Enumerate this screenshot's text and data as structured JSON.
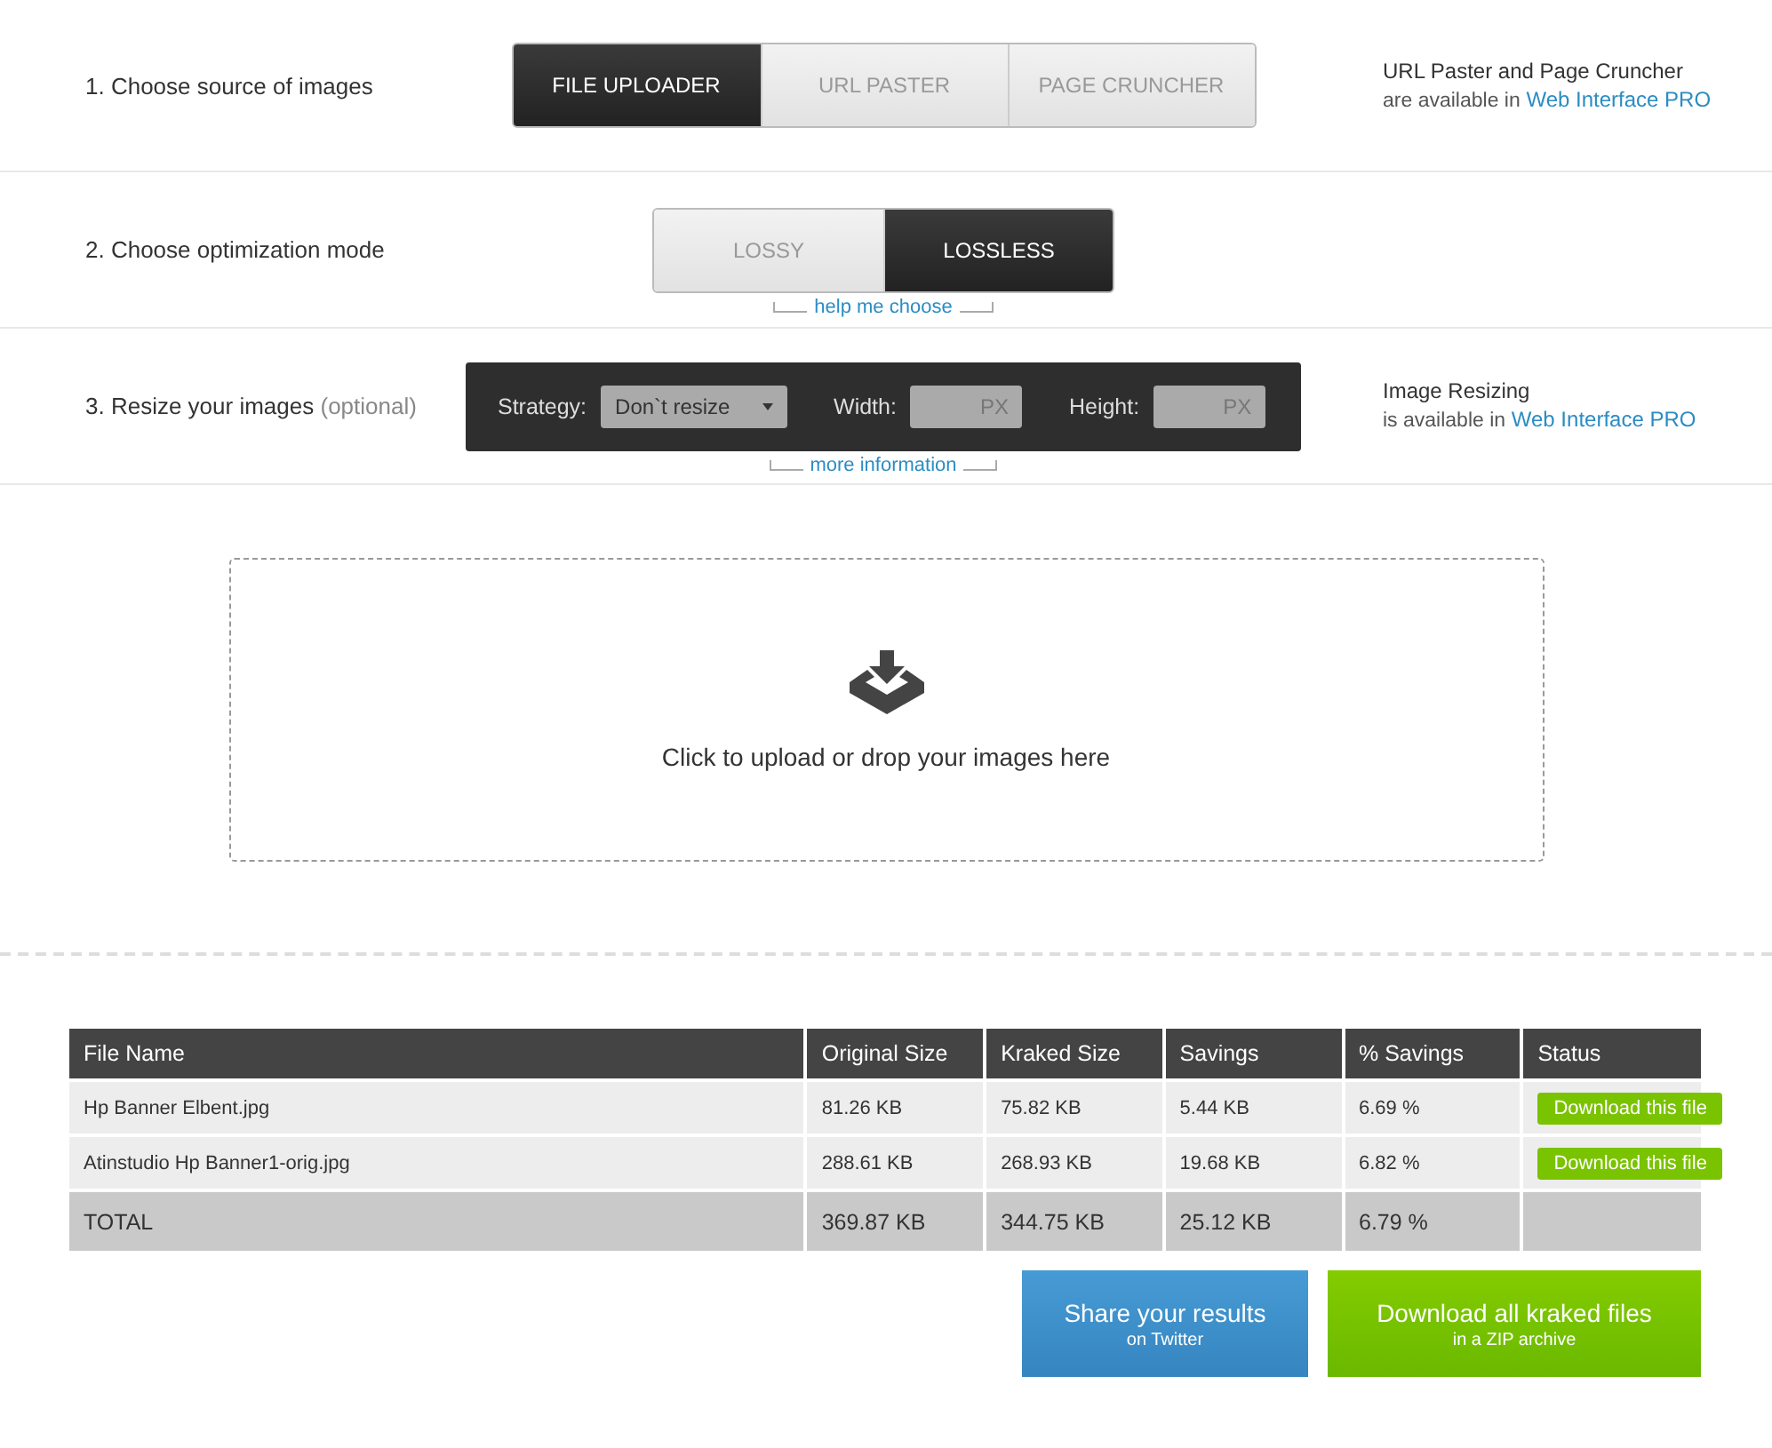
{
  "steps": [
    {
      "kind": "segmented",
      "label": "1. Choose source of images",
      "options": [
        {
          "label": "FILE UPLOADER",
          "selected": true
        },
        {
          "label": "URL PASTER",
          "selected": false
        },
        {
          "label": "PAGE CRUNCHER",
          "selected": false
        }
      ],
      "note": {
        "line1": "URL Paster and Page Cruncher",
        "line2": "are available in",
        "link": "Web Interface PRO"
      }
    },
    {
      "kind": "segmented",
      "label": "2. Choose optimization mode",
      "options": [
        {
          "label": "LOSSY",
          "selected": false
        },
        {
          "label": "LOSSLESS",
          "selected": true
        }
      ],
      "help": "help me choose"
    },
    {
      "kind": "resize",
      "label": "3. Resize your images",
      "hint": "(optional)",
      "strategy_label": "Strategy:",
      "strategy_value": "Don`t resize",
      "width_label": "Width:",
      "width_placeholder": "PX",
      "height_label": "Height:",
      "height_placeholder": "PX",
      "help": "more information",
      "note": {
        "line1": "Image Resizing",
        "line2": "is available in",
        "link": "Web Interface PRO"
      }
    }
  ],
  "dropzone": {
    "text": "Click to upload or drop your images here"
  },
  "table": {
    "columns": [
      "File Name",
      "Original Size",
      "Kraked Size",
      "Savings",
      "% Savings",
      "Status"
    ],
    "rows": [
      {
        "cells": [
          "Hp Banner Elbent.jpg",
          "81.26 KB",
          "75.82 KB",
          "5.44 KB",
          "6.69 %"
        ],
        "action": "Download this file"
      },
      {
        "cells": [
          "Atinstudio Hp Banner1-orig.jpg",
          "288.61 KB",
          "268.93 KB",
          "19.68 KB",
          "6.82 %"
        ],
        "action": "Download this file"
      }
    ],
    "total": [
      "TOTAL",
      "369.87 KB",
      "344.75 KB",
      "25.12 KB",
      "6.79 %"
    ]
  },
  "buttons": [
    {
      "kind": "share",
      "title": "Share your results",
      "subtitle": "on Twitter"
    },
    {
      "kind": "download",
      "title": "Download all kraked files",
      "subtitle": "in a ZIP archive"
    }
  ]
}
